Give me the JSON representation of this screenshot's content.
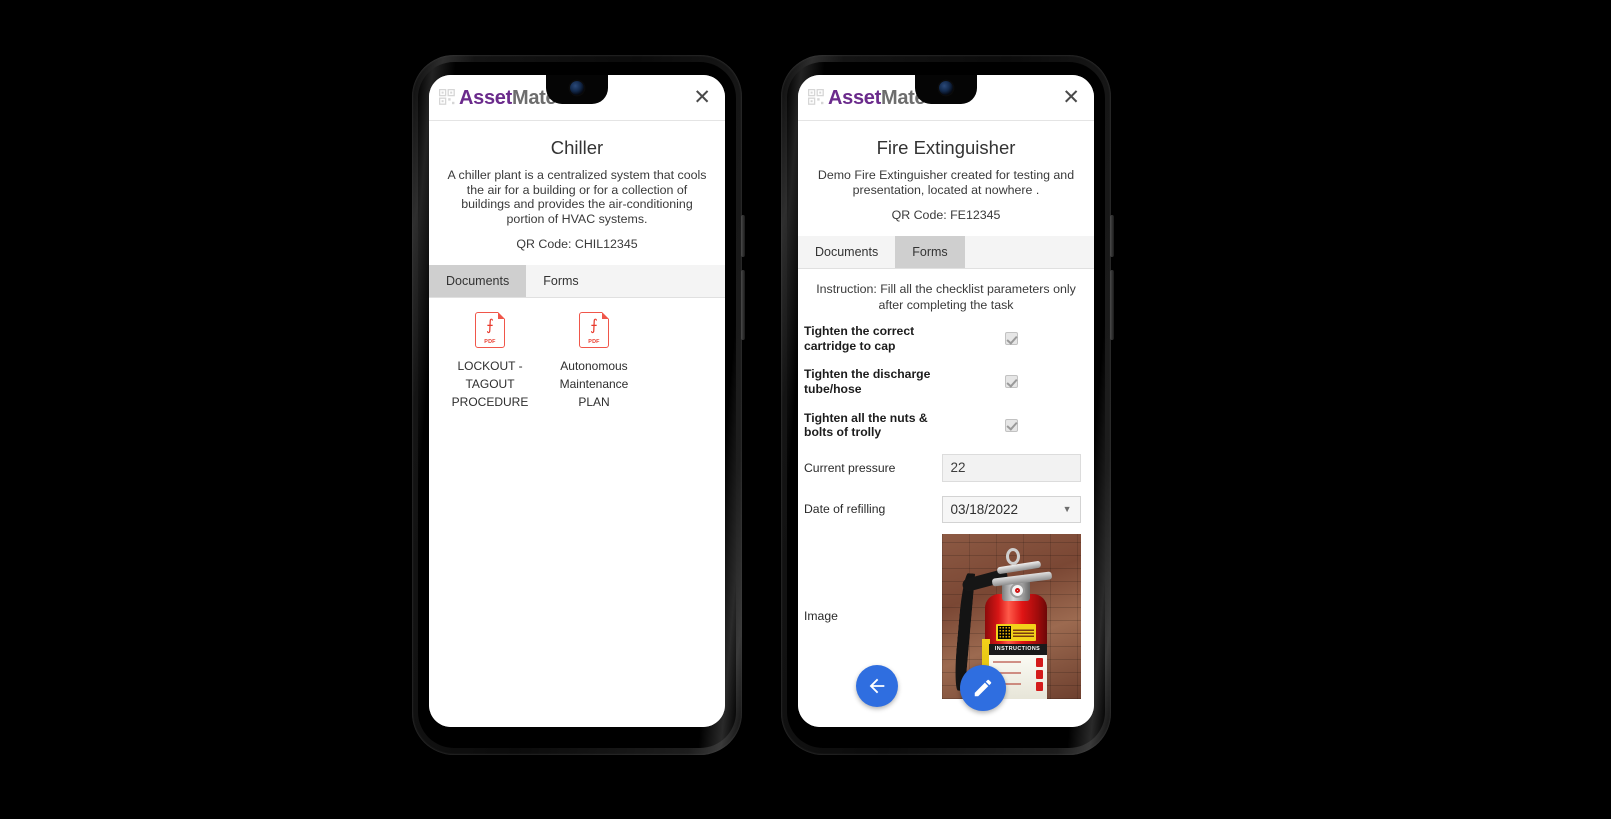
{
  "app": {
    "brand_asset": "Asset",
    "brand_mate": "Mate",
    "brand_icon": "qr-code-icon",
    "close_label": "✕"
  },
  "phones": [
    {
      "id": "left",
      "asset": {
        "title": "Chiller",
        "description": "A chiller plant is a centralized system that cools the air for a building or for a collection of buildings and provides the air-conditioning portion of HVAC systems.",
        "qr_code": "QR Code: CHIL12345"
      },
      "tabs": [
        {
          "label": "Documents",
          "active": true
        },
        {
          "label": "Forms",
          "active": false
        }
      ],
      "documents": [
        {
          "name": "LOCKOUT - TAGOUT PROCEDURE",
          "type": "PDF",
          "badge": "PDF"
        },
        {
          "name": "Autonomous Maintenance PLAN",
          "type": "PDF",
          "badge": "PDF"
        }
      ]
    },
    {
      "id": "right",
      "asset": {
        "title": "Fire Extinguisher",
        "description": "Demo Fire Extinguisher created for testing and presentation, located at nowhere .",
        "qr_code": "QR Code: FE12345"
      },
      "tabs": [
        {
          "label": "Documents",
          "active": false
        },
        {
          "label": "Forms",
          "active": true
        }
      ],
      "form": {
        "instruction": "Instruction: Fill all the checklist parameters only after completing the task",
        "fields": [
          {
            "label": "Tighten the correct cartridge to cap",
            "type": "checkbox",
            "value": "checked"
          },
          {
            "label": "Tighten the discharge tube/hose",
            "type": "checkbox",
            "value": "checked"
          },
          {
            "label": "Tighten all the nuts & bolts of trolly",
            "type": "checkbox",
            "value": "checked"
          },
          {
            "label": "Current pressure",
            "type": "text",
            "value": "22"
          },
          {
            "label": "Date of refilling",
            "type": "select",
            "value": "03/18/2022"
          },
          {
            "label": "Image",
            "type": "image",
            "value": "fire-extinguisher-photo"
          }
        ]
      },
      "actions": [
        {
          "name": "back-button",
          "icon": "arrow-left-icon"
        },
        {
          "name": "edit-button",
          "icon": "pencil-icon"
        }
      ]
    }
  ],
  "colors": {
    "brand_purple": "#6b2b8c",
    "brand_gray": "#6d6d6d",
    "fab_blue": "#2f6ee0",
    "pdf_red": "#f0564a",
    "tab_active": "#cfcfcf"
  }
}
